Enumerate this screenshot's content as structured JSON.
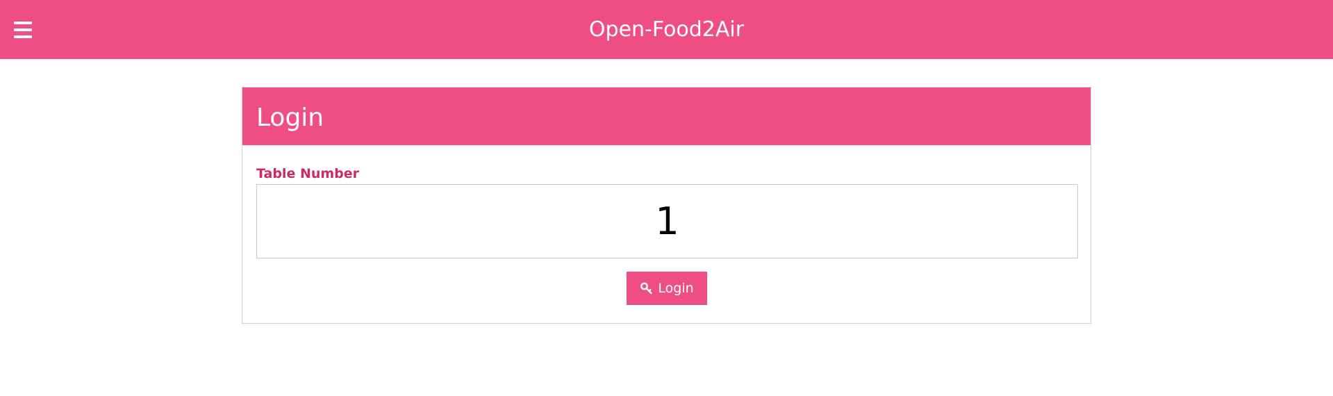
{
  "header": {
    "menu_icon": "hamburger-menu-icon",
    "title": "Open-Food2Air"
  },
  "login_card": {
    "title": "Login",
    "table_number_label": "Table Number",
    "table_number_value": "1",
    "login_button_label": "Login",
    "login_button_icon": "key-icon"
  },
  "colors": {
    "accent": "#ef4e85",
    "label": "#cd2a5f",
    "border": "#cfcfcf"
  }
}
